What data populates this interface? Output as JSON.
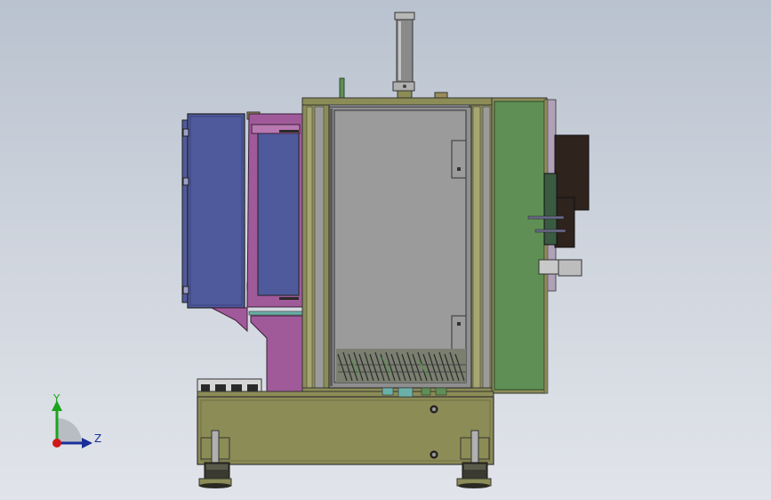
{
  "viewport": {
    "background_top": "#b9c2cf",
    "background_bottom": "#e1e4ea"
  },
  "triad": {
    "y_label": "Y",
    "z_label": "Z",
    "y_color": "#1ba51b",
    "z_color": "#1b2f9b",
    "origin_color": "#d01818"
  },
  "model_colors": {
    "frame_olive": "#8c8c57",
    "panel_grey": "#9b9b9b",
    "door_green": "#5f8f55",
    "blue_panel": "#4f5a9c",
    "magenta_part": "#a05a9a",
    "dark_block": "#2e231d",
    "cylinder_grey": "#8a8a8a",
    "foot_dark": "#3a3a30"
  }
}
